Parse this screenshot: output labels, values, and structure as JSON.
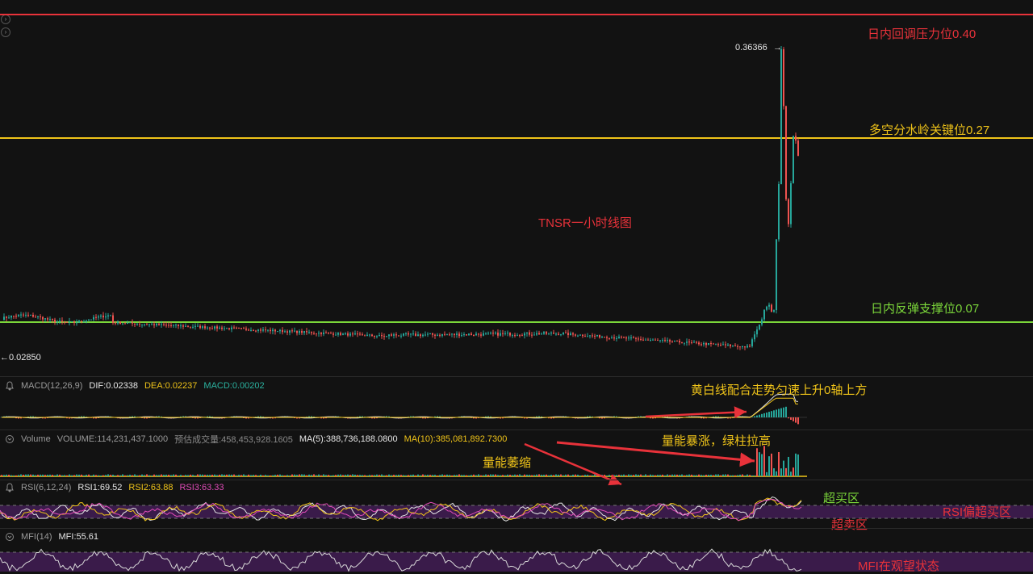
{
  "chart_title": "TNSR一小时线图",
  "price_panel": {
    "high_label": "0.36366",
    "low_label": "0.02850",
    "levels": [
      {
        "label": "日内回调压力位0.40",
        "value": 0.4,
        "color": "#e8323a"
      },
      {
        "label": "多空分水岭关键位0.27",
        "value": 0.27,
        "color": "#f0c419"
      },
      {
        "label": "日内反弹支撑位0.07",
        "value": 0.07,
        "color": "#7bd63a"
      }
    ]
  },
  "macd": {
    "name": "MACD(12,26,9)",
    "dif": "DIF:0.02338",
    "dea": "DEA:0.02237",
    "macd": "MACD:0.00202",
    "annotation": "黄白线配合走势匀速上升0轴上方"
  },
  "volume": {
    "name": "Volume",
    "volume": "VOLUME:114,231,437.1000",
    "estimate": "预估成交量:458,453,928.1605",
    "ma5": "MA(5):388,736,188.0800",
    "ma10": "MA(10):385,081,892.7300",
    "annotation_surge": "量能暴涨，绿柱拉高",
    "annotation_shrink": "量能萎缩"
  },
  "rsi": {
    "name": "RSI(6,12,24)",
    "rsi1": "RSI1:69.52",
    "rsi2": "RSI2:63.88",
    "rsi3": "RSI3:63.33",
    "overbought": "超买区",
    "oversold": "超卖区",
    "state": "RSI偏超买区"
  },
  "mfi": {
    "name": "MFI(14)",
    "value": "MFI:55.61",
    "state": "MFI在观望状态"
  },
  "colors": {
    "up": "#26a69a",
    "down": "#ef5350",
    "background": "#121212",
    "dif_line": "#e6e6e6",
    "dea_line": "#f0c419",
    "rsi_band": "#3a1b4a",
    "arrow": "#e8323a"
  },
  "chart_data": {
    "type": "candlestick",
    "title": "TNSR一小时线图",
    "price_markers": {
      "high": 0.36366,
      "low": 0.0285
    },
    "segments": [
      {
        "phase": "flat",
        "approx_price": 0.07
      },
      {
        "phase": "dip",
        "approx_price": 0.045
      },
      {
        "phase": "spike",
        "high": 0.36366
      },
      {
        "phase": "pullback",
        "approx_price": 0.2
      }
    ],
    "indicators": {
      "MACD": {
        "DIF": 0.02338,
        "DEA": 0.02237,
        "MACD": 0.00202
      },
      "VOLUME": {
        "VOLUME": 114231437.1,
        "MA5": 388736188.08,
        "MA10": 385081892.73
      },
      "RSI": {
        "RSI1": 69.52,
        "RSI2": 63.88,
        "RSI3": 63.33
      },
      "MFI": {
        "MFI": 55.61
      }
    }
  }
}
